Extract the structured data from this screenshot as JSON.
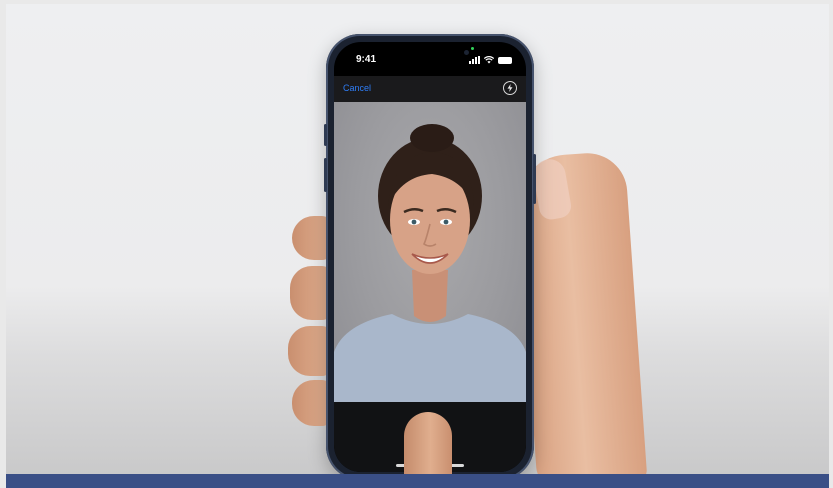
{
  "status_bar": {
    "time": "9:41"
  },
  "camera": {
    "cancel_label": "Cancel",
    "flash_icon": "flash-icon"
  },
  "colors": {
    "accent": "#2f7df6",
    "caption_bar": "#3a4f86",
    "phone_frame": "#1b2230"
  }
}
